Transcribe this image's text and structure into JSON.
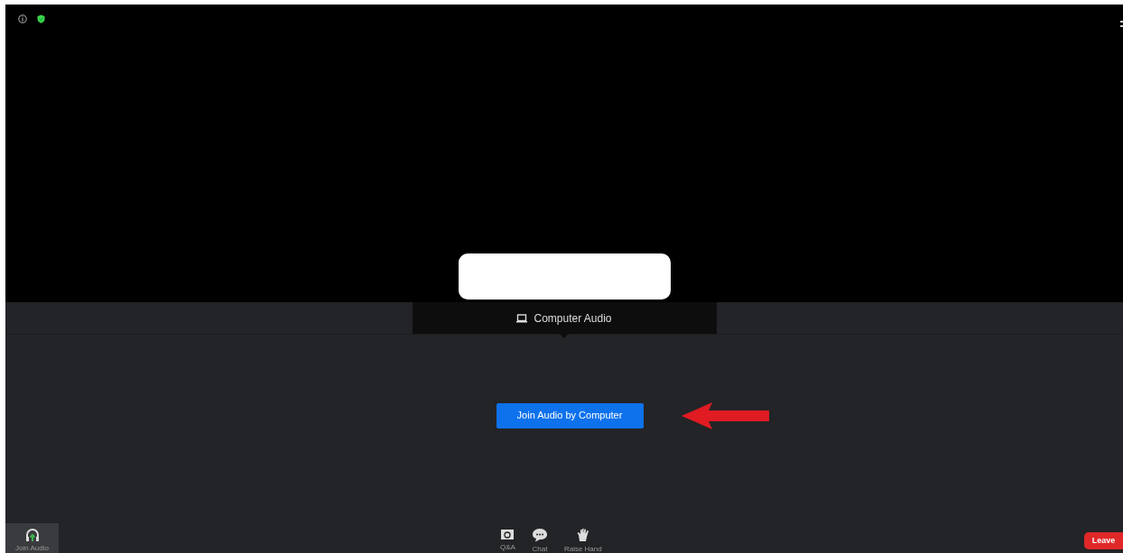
{
  "audio_tabs": [
    {
      "label": "Computer Audio",
      "selected": true
    }
  ],
  "join_button": "Join Audio by Computer",
  "toolbar": [
    {
      "kind": "audio",
      "label": "Join Audio"
    },
    {
      "kind": "qa",
      "label": "Q&A"
    },
    {
      "kind": "chat",
      "label": "Chat"
    },
    {
      "kind": "hand",
      "label": "Raise Hand"
    }
  ],
  "leave_button": "Leave"
}
